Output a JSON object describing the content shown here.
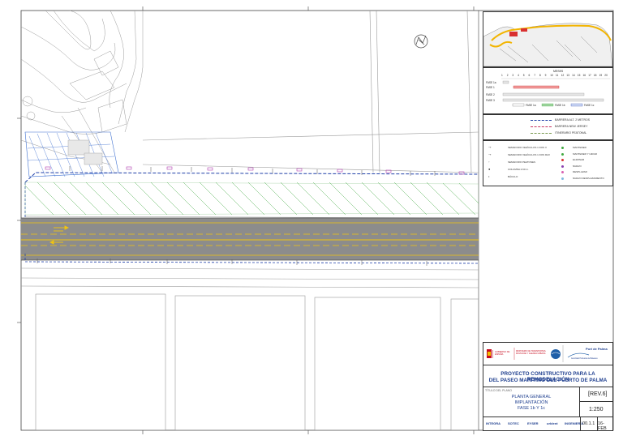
{
  "phases": {
    "header": "MESES",
    "months": [
      "1",
      "2",
      "3",
      "4",
      "5",
      "6",
      "7",
      "8",
      "9",
      "10",
      "11",
      "12",
      "13",
      "14",
      "15",
      "16",
      "17",
      "18",
      "19",
      "20"
    ],
    "rows": [
      "FASE 1a",
      "FASE 1",
      "FASE 2",
      "FASE 3"
    ],
    "legend": [
      "FASE 1a",
      "FASE 1b",
      "FASE 1c"
    ]
  },
  "barriers": [
    {
      "label": "BARRERA ALT. 2 METROS",
      "color": "#1f3fa8"
    },
    {
      "label": "BARRERA NEW JERSEY",
      "color": "#c8325f"
    },
    {
      "label": "ITINERARIO PEATONAL",
      "color": "#7a9a4f"
    }
  ],
  "symbols_left": [
    "SEMAFORO VEHÍCULOS 1 DOS V",
    "SEMAFORO VEHÍCULOS 1 DOS RAV",
    "SEMAFORO PEATONES",
    "COLUMNA 2.60 m.",
    "BÁCULO"
  ],
  "symbols_right": [
    {
      "label": "MANTENER",
      "color": "#3fa83f"
    },
    {
      "label": "MANTENER Y GIRAR",
      "color": "#3fa83f"
    },
    {
      "label": "ELIMINAR",
      "color": "#d93030"
    },
    {
      "label": "NUEVO",
      "color": "#8a3fb0"
    },
    {
      "label": "DESPLAZAR",
      "color": "#d95fb0"
    },
    {
      "label": "NUEVO DESPLAZAMIENTO",
      "color": "#7fb8e0"
    }
  ],
  "logos": {
    "gobierno": "GOBIERNO DE ESPAÑA",
    "ministerio": "MINISTERIO DE TRANSPORTES, MOVILIDAD Y AGENDA URBANA",
    "port": "Port de Palma",
    "autoritat": "Autoridad Portuaria de Baleares"
  },
  "project_title": {
    "line1": "PROYECTO CONSTRUCTIVO PARA LA REMODELACIÓN",
    "line2": "DEL PASEO MARÍTIMO DEL PUERTO DE PALMA"
  },
  "plan": {
    "box_label": "TÍTULO DEL PLANO",
    "line1": "PLANTA GENERAL",
    "line2": "IMPLANTACIÓN",
    "line3": "FASE 1b Y 1c"
  },
  "revision": "REV.6",
  "scale": "1:250",
  "plan_number": "00.1.1",
  "date": "16-FEB",
  "companies": [
    "INTEGRA",
    "SOTEC",
    "EYSER",
    "urblent",
    "INGENIERÍA"
  ]
}
